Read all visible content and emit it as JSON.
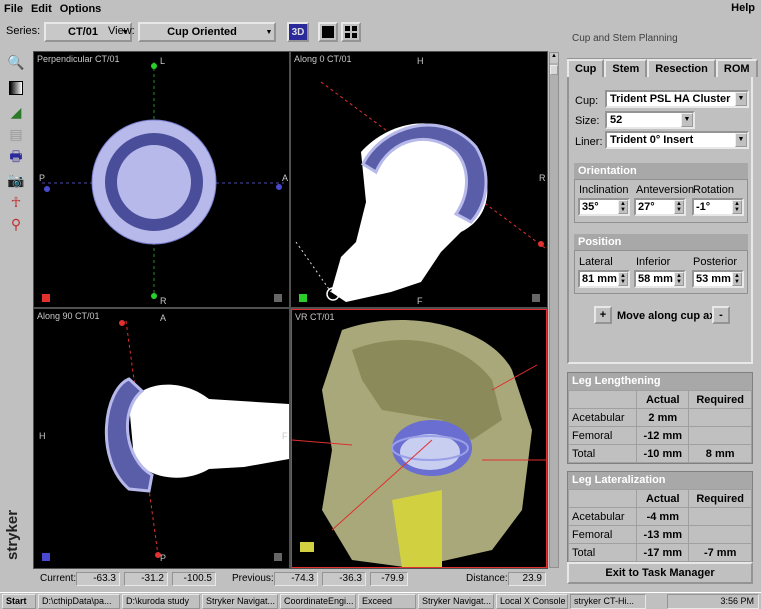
{
  "menu": {
    "file": "File",
    "edit": "Edit",
    "options": "Options",
    "help": "Help"
  },
  "toolbar": {
    "series_label": "Series:",
    "series_value": "CT/01",
    "view_label": "View:",
    "view_value": "Cup Oriented",
    "btn_3d": "3D"
  },
  "viewports": {
    "top_left": {
      "title": "Perpendicular CT/01",
      "marks": {
        "top": "L",
        "left": "P",
        "right": "A",
        "bottom": "R"
      }
    },
    "top_right": {
      "title": "Along 0 CT/01",
      "marks": {
        "top": "H",
        "right": "R",
        "bottom": "F"
      }
    },
    "bottom_left": {
      "title": "Along 90 CT/01",
      "marks": {
        "top": "A",
        "left": "H",
        "right": "F",
        "bottom": "P"
      }
    },
    "bottom_right": {
      "title": "VR CT/01"
    }
  },
  "brand": "stryker",
  "panel": {
    "title": "Cup and Stem Planning",
    "tabs": [
      "Cup",
      "Stem",
      "Resection",
      "ROM"
    ],
    "cup_label": "Cup:",
    "cup_value": "Trident PSL HA Cluster",
    "size_label": "Size:",
    "size_value": "52",
    "liner_label": "Liner:",
    "liner_value": "Trident 0° Insert",
    "orientation": {
      "header": "Orientation",
      "inclination_label": "Inclination",
      "inclination": "35°",
      "anteversion_label": "Anteversion",
      "anteversion": "27°",
      "rotation_label": "Rotation",
      "rotation": "-1°"
    },
    "position": {
      "header": "Position",
      "lateral_label": "Lateral",
      "lateral": "81 mm",
      "inferior_label": "Inferior",
      "inferior": "58 mm",
      "posterior_label": "Posterior",
      "posterior": "53 mm"
    },
    "move_plus": "+",
    "move_label": "Move along cup axis",
    "move_minus": "-"
  },
  "leg_lengthening": {
    "header": "Leg Lengthening",
    "col_actual": "Actual",
    "col_required": "Required",
    "rows": [
      {
        "label": "Acetabular",
        "actual": "2 mm",
        "required": ""
      },
      {
        "label": "Femoral",
        "actual": "-12 mm",
        "required": ""
      },
      {
        "label": "Total",
        "actual": "-10 mm",
        "required": "8 mm"
      }
    ]
  },
  "leg_lateralization": {
    "header": "Leg Lateralization",
    "col_actual": "Actual",
    "col_required": "Required",
    "rows": [
      {
        "label": "Acetabular",
        "actual": "-4 mm",
        "required": ""
      },
      {
        "label": "Femoral",
        "actual": "-13 mm",
        "required": ""
      },
      {
        "label": "Total",
        "actual": "-17 mm",
        "required": "-7 mm"
      }
    ]
  },
  "exit_button": "Exit to Task Manager",
  "status": {
    "current_label": "Current:",
    "current": [
      "-63.3",
      "-31.2",
      "-100.5"
    ],
    "previous_label": "Previous:",
    "previous": [
      "-74.3",
      "-36.3",
      "-79.9"
    ],
    "distance_label": "Distance:",
    "distance": "23.9"
  },
  "taskbar": {
    "start": "Start",
    "items": [
      "D:\\cthipData\\pa...",
      "D:\\kuroda study",
      "Stryker Navigat...",
      "CoordinateEngi...",
      "Exceed",
      "Stryker Navigat...",
      "Local X Console",
      "stryker CT-Hi..."
    ],
    "clock": "3:56 PM"
  },
  "colors": {
    "cup_fill": "#b7b9ea",
    "cup_dark": "#5a5ea8",
    "panel_bg": "#c0c0c0",
    "header_bg": "#a8a8a8"
  }
}
